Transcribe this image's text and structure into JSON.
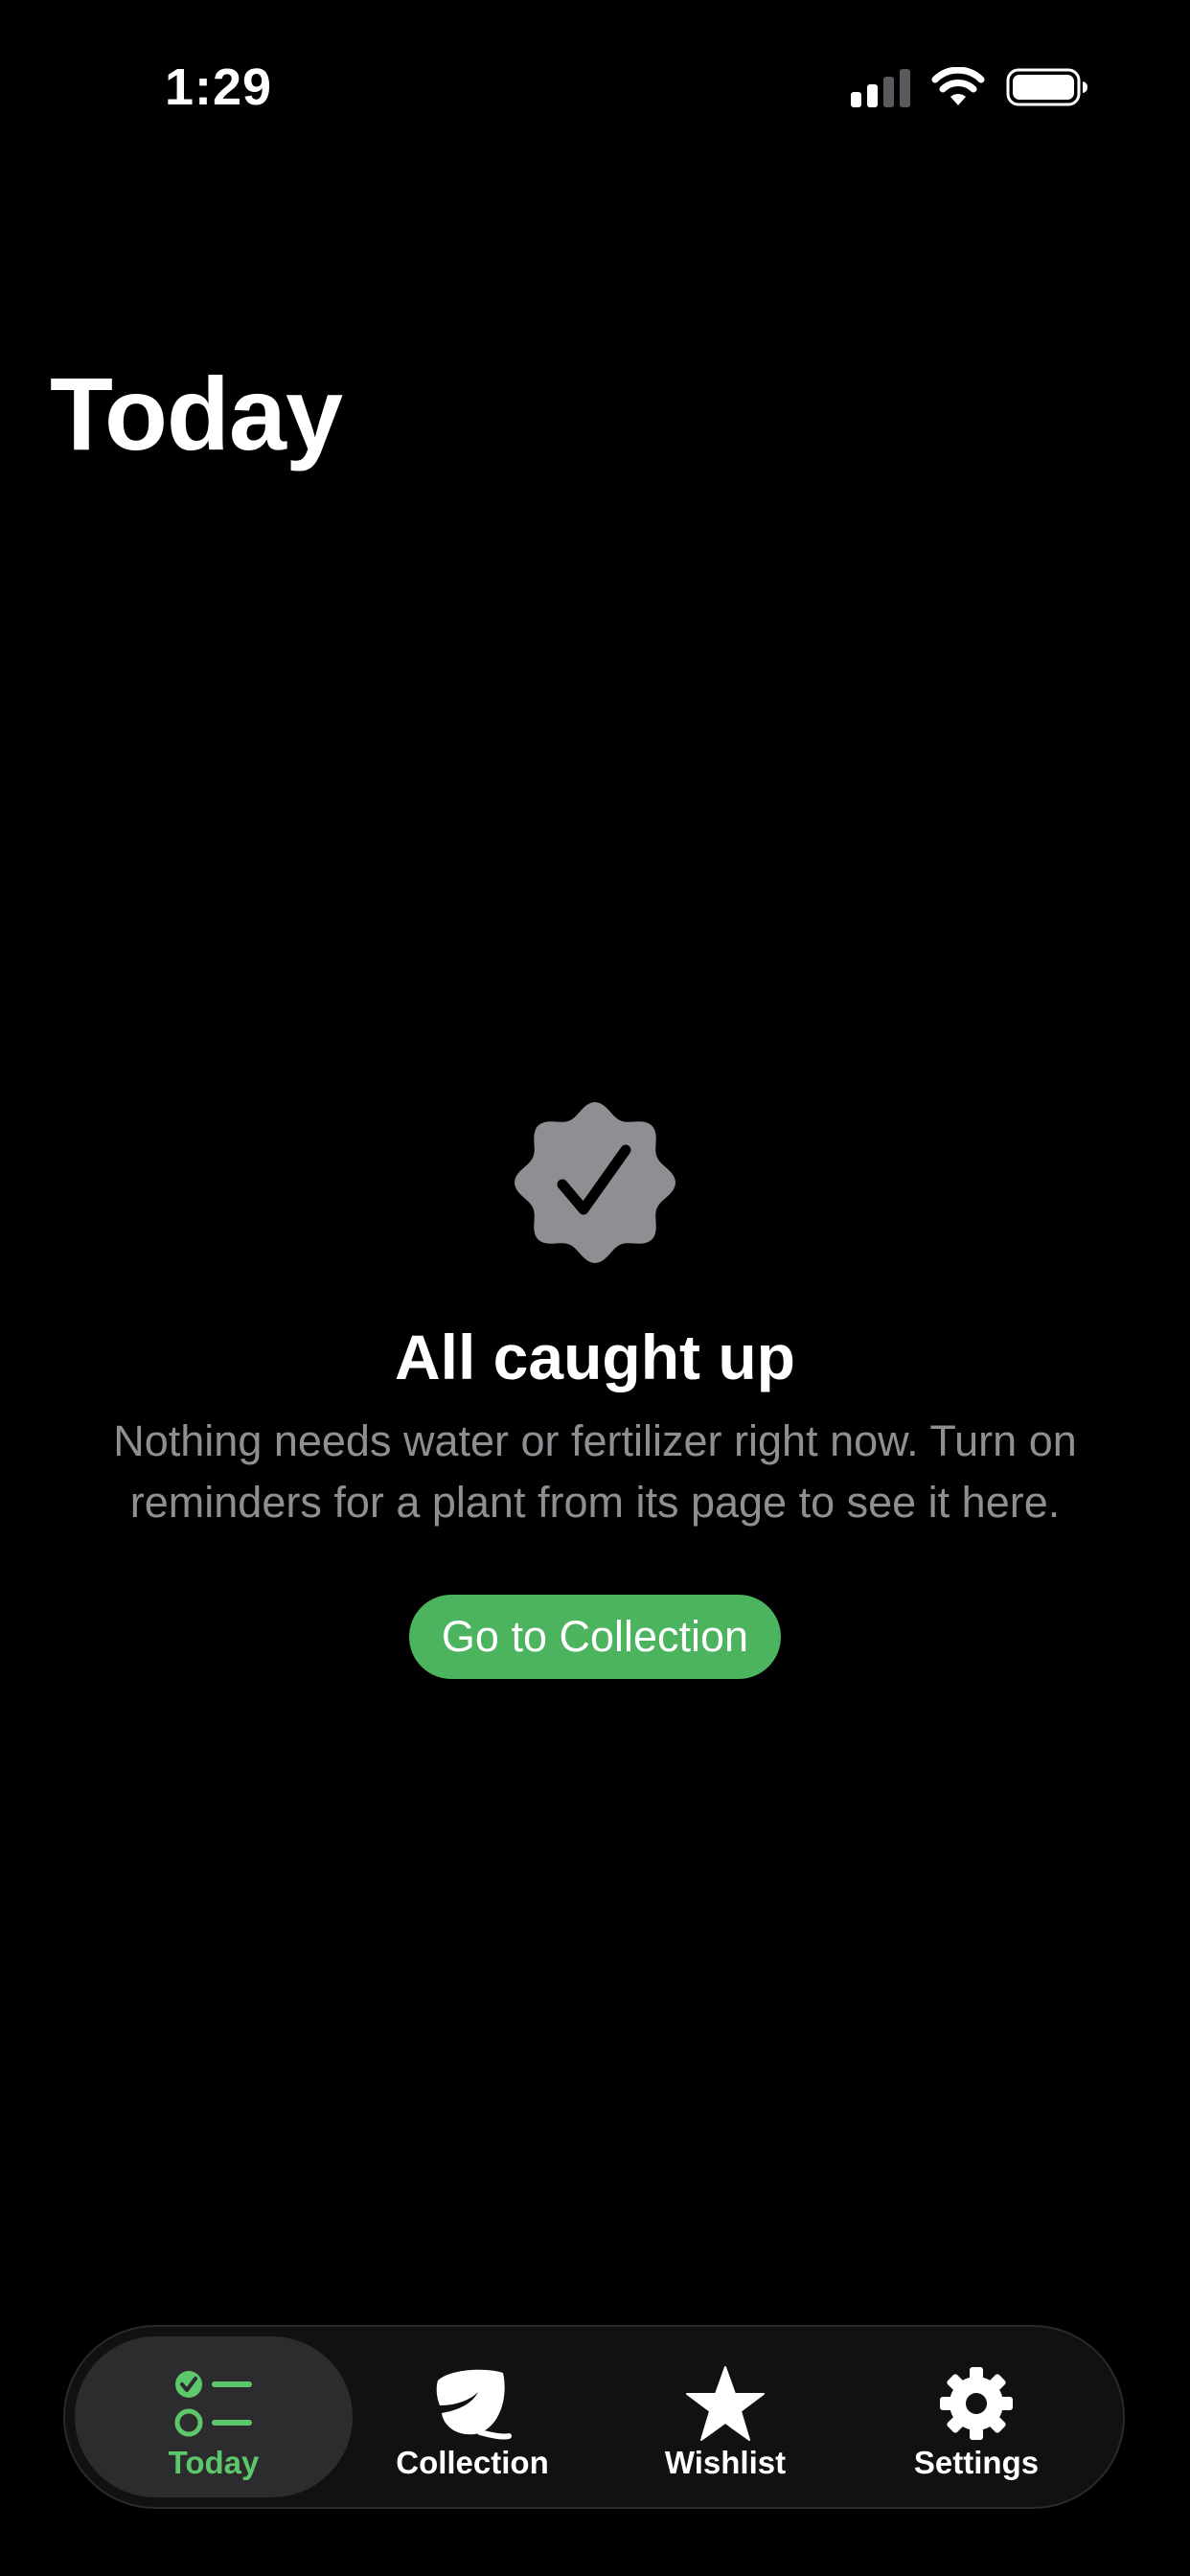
{
  "status_bar": {
    "time": "1:29",
    "icons": [
      "cellular-signal-icon",
      "wifi-icon",
      "battery-icon"
    ]
  },
  "header": {
    "title": "Today"
  },
  "empty_state": {
    "icon": "checkmark-seal-icon",
    "title": "All caught up",
    "message": "Nothing needs water or fertilizer right now. Turn on reminders for a plant from its page to see it here.",
    "button_label": "Go to Collection"
  },
  "tab_bar": {
    "active": "Today",
    "tabs": [
      {
        "label": "Today",
        "icon": "checklist-icon",
        "active": true
      },
      {
        "label": "Collection",
        "icon": "leaf-icon",
        "active": false
      },
      {
        "label": "Wishlist",
        "icon": "star-icon",
        "active": false
      },
      {
        "label": "Settings",
        "icon": "gear-icon",
        "active": false
      }
    ]
  },
  "colors": {
    "background": "#000000",
    "accent": "#4cb35f",
    "active_tab_text": "#5cc76b",
    "secondary_text": "#8e8e93",
    "badge": "#8e8e93"
  }
}
